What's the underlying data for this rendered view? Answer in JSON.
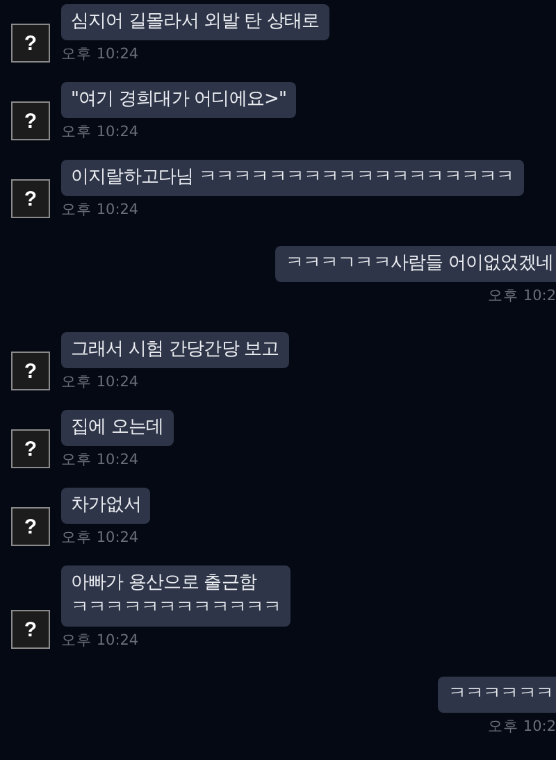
{
  "messages": [
    {
      "kind": "received",
      "avatar": "?",
      "lines": [
        "심지어 길몰라서 외발 탄 상태로"
      ],
      "time": "오후 10:24"
    },
    {
      "kind": "received",
      "avatar": "?",
      "lines": [
        "\"여기 경희대가 어디에요>\""
      ],
      "time": "오후 10:24"
    },
    {
      "kind": "received",
      "avatar": "?",
      "lines": [
        "이지랄하고다님 ㅋㅋㅋㅋㅋㅋㅋㅋㅋㅋㅋㅋㅋㅋㅋㅋㅋㅋ"
      ],
      "time": "오후 10:24"
    },
    {
      "kind": "sent",
      "lines": [
        "ㅋㅋㅋㄱㅋㅋ사람들 어이없었겠네"
      ],
      "time": "오후 10:2"
    },
    {
      "kind": "received",
      "avatar": "?",
      "lines": [
        "그래서 시험 간당간당 보고"
      ],
      "time": "오후 10:24"
    },
    {
      "kind": "received",
      "avatar": "?",
      "lines": [
        "집에 오는데"
      ],
      "time": "오후 10:24"
    },
    {
      "kind": "received",
      "avatar": "?",
      "lines": [
        "차가없서"
      ],
      "time": "오후 10:24"
    },
    {
      "kind": "received",
      "avatar": "?",
      "lines": [
        "아빠가 용산으로 출근함",
        "ㅋㅋㅋㅋㅋㅋㅋㅋㅋㅋㅋㅋ"
      ],
      "time": "오후 10:24"
    },
    {
      "kind": "sent",
      "lines": [
        "ㅋㅋㅋㅋㅋㅋ"
      ],
      "time": "오후 10:2"
    }
  ]
}
